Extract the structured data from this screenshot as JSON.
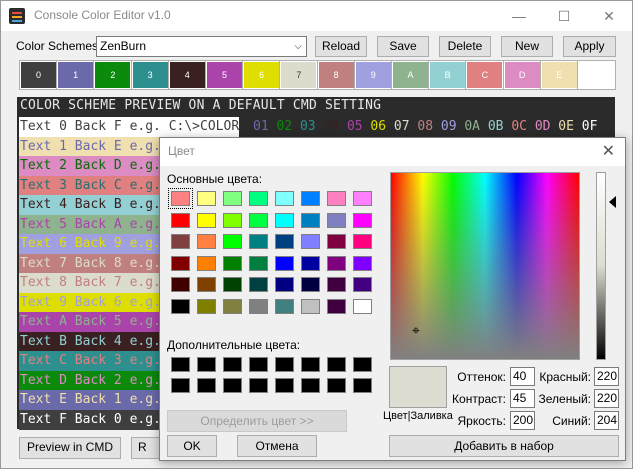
{
  "window": {
    "title": "Console Color Editor v1.0",
    "minimize": "—",
    "maximize": "☐",
    "close": "✕"
  },
  "toolbar": {
    "schemes_label": "Color Schemes:",
    "scheme_value": "ZenBurn",
    "reload": "Reload",
    "save": "Save",
    "delete": "Delete",
    "new": "New",
    "apply": "Apply"
  },
  "swatches": [
    {
      "label": "0",
      "bg": "#3f3f3f",
      "fg": "#ffffff"
    },
    {
      "label": "1",
      "bg": "#6a6aaa",
      "fg": "#ffffff"
    },
    {
      "label": "2",
      "bg": "#0b8a0b",
      "fg": "#ffffff"
    },
    {
      "label": "3",
      "bg": "#2e8f8f",
      "fg": "#ffffff"
    },
    {
      "label": "4",
      "bg": "#3a2020",
      "fg": "#ffffff"
    },
    {
      "label": "5",
      "bg": "#aa44aa",
      "fg": "#ffffff"
    },
    {
      "label": "6",
      "bg": "#dede00",
      "fg": "#ffffff"
    },
    {
      "label": "7",
      "bg": "#dcdccc",
      "fg": "#333333"
    },
    {
      "label": "8",
      "bg": "#c08080",
      "fg": "#ffffff"
    },
    {
      "label": "9",
      "bg": "#a0a0e0",
      "fg": "#ffffff"
    },
    {
      "label": "A",
      "bg": "#8fb28f",
      "fg": "#ffffff"
    },
    {
      "label": "B",
      "bg": "#93d0d3",
      "fg": "#ffffff"
    },
    {
      "label": "C",
      "bg": "#e08080",
      "fg": "#ffffff"
    },
    {
      "label": "D",
      "bg": "#dc8cc3",
      "fg": "#ffffff"
    },
    {
      "label": "E",
      "bg": "#f0dfaf",
      "fg": "#ffffff"
    },
    {
      "label": "",
      "bg": "#ffffff",
      "fg": "#ffffff"
    }
  ],
  "preview": {
    "header": "COLOR SCHEME PREVIEW ON A DEFAULT CMD SETTING",
    "digits": [
      {
        "t": "01",
        "c": "#6a6aaa"
      },
      {
        "t": "02",
        "c": "#0b8a0b"
      },
      {
        "t": "03",
        "c": "#2e8f8f"
      },
      {
        "t": "04",
        "c": "#3a2020"
      },
      {
        "t": "05",
        "c": "#aa44aa"
      },
      {
        "t": "06",
        "c": "#dede00"
      },
      {
        "t": "07",
        "c": "#dcdccc"
      },
      {
        "t": "08",
        "c": "#c08080"
      },
      {
        "t": "09",
        "c": "#a0a0e0"
      },
      {
        "t": "0A",
        "c": "#8fb28f"
      },
      {
        "t": "0B",
        "c": "#93d0d3"
      },
      {
        "t": "0C",
        "c": "#e08080"
      },
      {
        "t": "0D",
        "c": "#dc8cc3"
      },
      {
        "t": "0E",
        "c": "#f0dfaf"
      },
      {
        "t": "0F",
        "c": "#ffffff"
      }
    ],
    "rows": [
      {
        "text": "Text 0 Back F e.g. C:\\>COLOR",
        "bg": "#ffffff",
        "fg": "#3f3f3f"
      },
      {
        "text": "Text 1 Back E e.g.",
        "bg": "#f0dfaf",
        "fg": "#6a6aaa"
      },
      {
        "text": "Text 2 Back D e.g.",
        "bg": "#dc8cc3",
        "fg": "#0b6a0b"
      },
      {
        "text": "Text 3 Back C e.g.",
        "bg": "#e08080",
        "fg": "#2e6f6f"
      },
      {
        "text": "Text 4 Back B e.g.",
        "bg": "#93d0d3",
        "fg": "#3a2020"
      },
      {
        "text": "Text 5 Back A e.g.",
        "bg": "#8fb28f",
        "fg": "#aa44aa"
      },
      {
        "text": "Text 6 Back 9 e.g.",
        "bg": "#a0a0e0",
        "fg": "#dede00"
      },
      {
        "text": "Text 7 Back 8 e.g.",
        "bg": "#c08080",
        "fg": "#dcdccc"
      },
      {
        "text": "Text 8 Back 7 e.g.",
        "bg": "#dcdccc",
        "fg": "#c08080"
      },
      {
        "text": "Text 9 Back 6 e.g.",
        "bg": "#dede00",
        "fg": "#a0a0e0"
      },
      {
        "text": "Text A Back 5 e.g.",
        "bg": "#aa44aa",
        "fg": "#8fb28f"
      },
      {
        "text": "Text B Back 4 e.g.",
        "bg": "#3a2020",
        "fg": "#93d0d3"
      },
      {
        "text": "Text C Back 3 e.g.",
        "bg": "#2e8f8f",
        "fg": "#e08080"
      },
      {
        "text": "Text D Back 2 e.g.",
        "bg": "#0b8a0b",
        "fg": "#dc8cc3"
      },
      {
        "text": "Text E Back 1 e.g.",
        "bg": "#6a6aaa",
        "fg": "#f0dfaf"
      },
      {
        "text": "Text F Back 0 e.g.",
        "bg": "#3f3f3f",
        "fg": "#ffffff"
      }
    ]
  },
  "bottom": {
    "preview_cmd": "Preview in CMD",
    "second_button": "R"
  },
  "dialog": {
    "title": "Цвет",
    "basic_label": "Основные цвета:",
    "custom_label": "Дополнительные цвета:",
    "define_button": "Определить цвет >>",
    "ok": "OK",
    "cancel": "Отмена",
    "solid_label": "Цвет|Заливка",
    "add_button": "Добавить в набор",
    "hue_label": "Оттенок:",
    "hue": "40",
    "sat_label": "Контраст:",
    "sat": "45",
    "lum_label": "Яркость:",
    "lum": "200",
    "red_label": "Красный:",
    "red": "220",
    "green_label": "Зеленый:",
    "green": "220",
    "blue_label": "Синий:",
    "blue": "204",
    "basic_colors": [
      "#ff8080",
      "#ffff80",
      "#80ff80",
      "#00ff80",
      "#80ffff",
      "#0080ff",
      "#ff80c0",
      "#ff80ff",
      "#ff0000",
      "#ffff00",
      "#80ff00",
      "#00ff40",
      "#00ffff",
      "#0080c0",
      "#8080c0",
      "#ff00ff",
      "#804040",
      "#ff8040",
      "#00ff00",
      "#008080",
      "#004080",
      "#8080ff",
      "#800040",
      "#ff0080",
      "#800000",
      "#ff8000",
      "#008000",
      "#008040",
      "#0000ff",
      "#0000a0",
      "#800080",
      "#8000ff",
      "#400000",
      "#804000",
      "#004000",
      "#004040",
      "#000080",
      "#000040",
      "#400040",
      "#400080",
      "#000000",
      "#808000",
      "#808040",
      "#808080",
      "#408080",
      "#c0c0c0",
      "#400040",
      "#ffffff"
    ],
    "custom_colors": [
      "#000000",
      "#000000",
      "#000000",
      "#000000",
      "#000000",
      "#000000",
      "#000000",
      "#000000",
      "#000000",
      "#000000",
      "#000000",
      "#000000",
      "#000000",
      "#000000",
      "#000000",
      "#000000"
    ]
  }
}
